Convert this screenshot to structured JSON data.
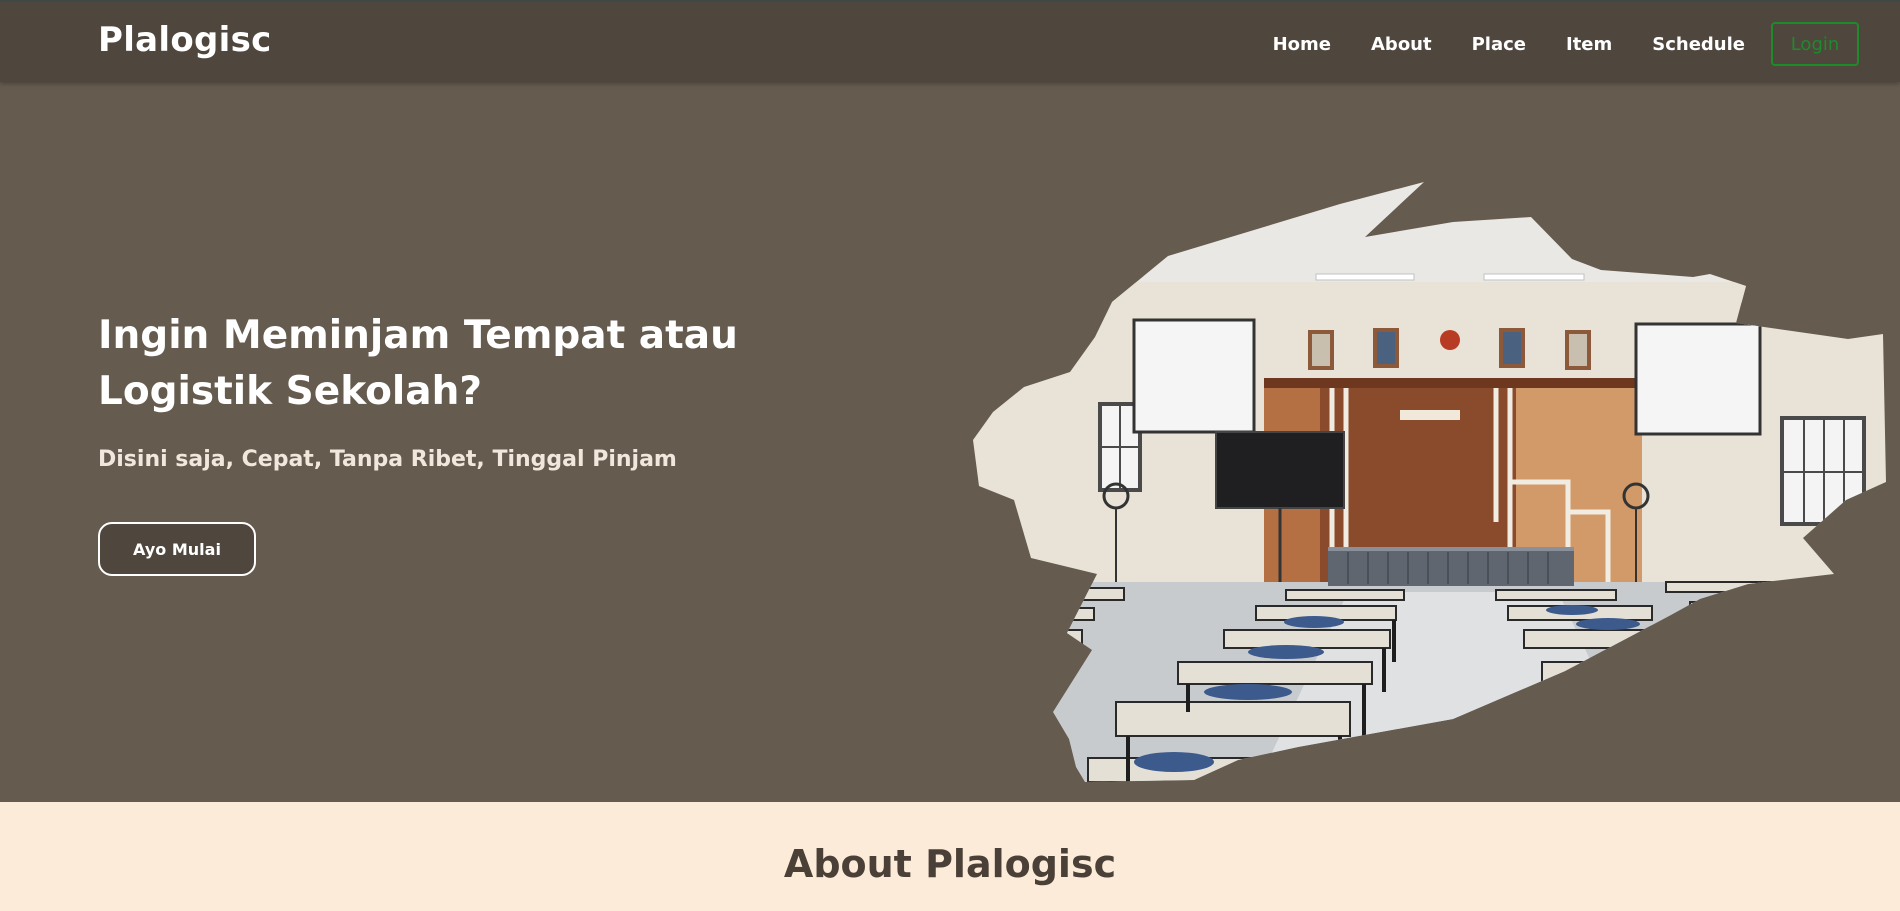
{
  "navbar": {
    "brand": "Plalogisc",
    "links": [
      "Home",
      "About",
      "Place",
      "Item",
      "Schedule"
    ],
    "login_label": "Login"
  },
  "hero": {
    "title": "Ingin Meminjam Tempat atau Logistik Sekolah?",
    "subtitle": "Disini saja, Cepat, Tanpa Ribet, Tinggal Pinjam",
    "cta_label": "Ayo Mulai",
    "image_icon": "classroom-photo"
  },
  "about": {
    "title": "About Plalogisc"
  },
  "colors": {
    "navbar_bg": "#4f463d",
    "hero_bg": "#655b4f",
    "about_bg": "#fbebd8",
    "login_accent": "#1f8a2a"
  }
}
